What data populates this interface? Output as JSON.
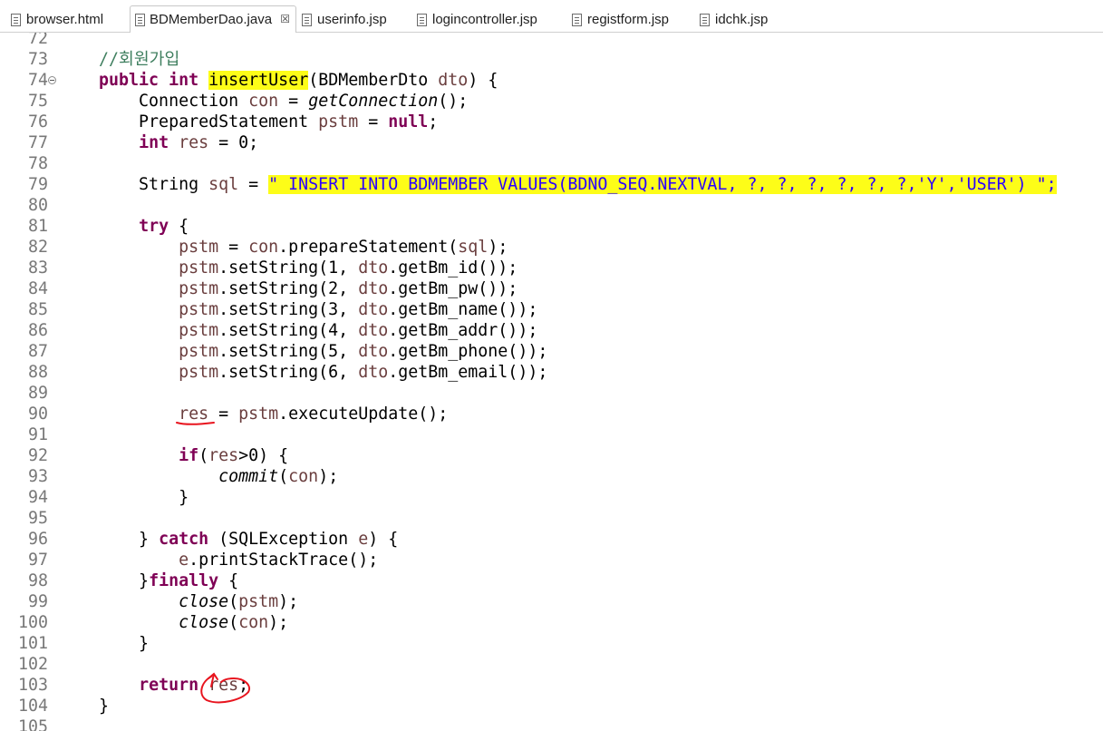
{
  "tabs": [
    {
      "label": "browser.html",
      "active": false
    },
    {
      "label": "BDMemberDao.java",
      "active": true,
      "close": "☒"
    },
    {
      "label": "userinfo.jsp",
      "active": false
    },
    {
      "label": "logincontroller.jsp",
      "active": false
    },
    {
      "label": "registform.jsp",
      "active": false
    },
    {
      "label": "idchk.jsp",
      "active": false
    }
  ],
  "editor": {
    "lines": [
      {
        "n": "72",
        "tokens": []
      },
      {
        "n": "73",
        "tokens": [
          {
            "t": "    //회원가입",
            "c": "cm"
          }
        ]
      },
      {
        "n": "74",
        "fold": true,
        "tokens": [
          {
            "t": "    "
          },
          {
            "t": "public",
            "c": "kw"
          },
          {
            "t": " "
          },
          {
            "t": "int",
            "c": "kw"
          },
          {
            "t": " "
          },
          {
            "t": "insertUser",
            "c": "hl"
          },
          {
            "t": "(BDMemberDto "
          },
          {
            "t": "dto",
            "c": "fld"
          },
          {
            "t": ") {"
          }
        ]
      },
      {
        "n": "75",
        "tokens": [
          {
            "t": "        Connection "
          },
          {
            "t": "con",
            "c": "fld"
          },
          {
            "t": " = "
          },
          {
            "t": "getConnection",
            "c": "it"
          },
          {
            "t": "();"
          }
        ]
      },
      {
        "n": "76",
        "tokens": [
          {
            "t": "        PreparedStatement "
          },
          {
            "t": "pstm",
            "c": "fld"
          },
          {
            "t": " = "
          },
          {
            "t": "null",
            "c": "kw"
          },
          {
            "t": ";"
          }
        ]
      },
      {
        "n": "77",
        "tokens": [
          {
            "t": "        "
          },
          {
            "t": "int",
            "c": "kw"
          },
          {
            "t": " "
          },
          {
            "t": "res",
            "c": "fld"
          },
          {
            "t": " = 0;"
          }
        ]
      },
      {
        "n": "78",
        "tokens": []
      },
      {
        "n": "79",
        "tokens": [
          {
            "t": "        String "
          },
          {
            "t": "sql",
            "c": "fld"
          },
          {
            "t": " = "
          },
          {
            "t": "\" INSERT INTO BDMEMBER VALUES(BDNO_SEQ.NEXTVAL, ?, ?, ?, ?, ?, ?,'Y','USER') \";",
            "c": "str hl"
          }
        ]
      },
      {
        "n": "80",
        "tokens": []
      },
      {
        "n": "81",
        "tokens": [
          {
            "t": "        "
          },
          {
            "t": "try",
            "c": "kw"
          },
          {
            "t": " {"
          }
        ]
      },
      {
        "n": "82",
        "tokens": [
          {
            "t": "            "
          },
          {
            "t": "pstm",
            "c": "fld"
          },
          {
            "t": " = "
          },
          {
            "t": "con",
            "c": "fld"
          },
          {
            "t": ".prepareStatement("
          },
          {
            "t": "sql",
            "c": "fld"
          },
          {
            "t": ");"
          }
        ]
      },
      {
        "n": "83",
        "tokens": [
          {
            "t": "            "
          },
          {
            "t": "pstm",
            "c": "fld"
          },
          {
            "t": ".setString(1, "
          },
          {
            "t": "dto",
            "c": "fld"
          },
          {
            "t": ".getBm_id());"
          }
        ]
      },
      {
        "n": "84",
        "tokens": [
          {
            "t": "            "
          },
          {
            "t": "pstm",
            "c": "fld"
          },
          {
            "t": ".setString(2, "
          },
          {
            "t": "dto",
            "c": "fld"
          },
          {
            "t": ".getBm_pw());"
          }
        ]
      },
      {
        "n": "85",
        "tokens": [
          {
            "t": "            "
          },
          {
            "t": "pstm",
            "c": "fld"
          },
          {
            "t": ".setString(3, "
          },
          {
            "t": "dto",
            "c": "fld"
          },
          {
            "t": ".getBm_name());"
          }
        ]
      },
      {
        "n": "86",
        "tokens": [
          {
            "t": "            "
          },
          {
            "t": "pstm",
            "c": "fld"
          },
          {
            "t": ".setString(4, "
          },
          {
            "t": "dto",
            "c": "fld"
          },
          {
            "t": ".getBm_addr());"
          }
        ]
      },
      {
        "n": "87",
        "tokens": [
          {
            "t": "            "
          },
          {
            "t": "pstm",
            "c": "fld"
          },
          {
            "t": ".setString(5, "
          },
          {
            "t": "dto",
            "c": "fld"
          },
          {
            "t": ".getBm_phone());"
          }
        ]
      },
      {
        "n": "88",
        "tokens": [
          {
            "t": "            "
          },
          {
            "t": "pstm",
            "c": "fld"
          },
          {
            "t": ".setString(6, "
          },
          {
            "t": "dto",
            "c": "fld"
          },
          {
            "t": ".getBm_email());"
          }
        ]
      },
      {
        "n": "89",
        "tokens": []
      },
      {
        "n": "90",
        "tokens": [
          {
            "t": "            "
          },
          {
            "t": "res",
            "c": "fld"
          },
          {
            "t": " = "
          },
          {
            "t": "pstm",
            "c": "fld"
          },
          {
            "t": ".executeUpdate();"
          }
        ]
      },
      {
        "n": "91",
        "tokens": []
      },
      {
        "n": "92",
        "tokens": [
          {
            "t": "            "
          },
          {
            "t": "if",
            "c": "kw"
          },
          {
            "t": "("
          },
          {
            "t": "res",
            "c": "fld"
          },
          {
            "t": ">0) {"
          }
        ]
      },
      {
        "n": "93",
        "tokens": [
          {
            "t": "                "
          },
          {
            "t": "commit",
            "c": "it"
          },
          {
            "t": "("
          },
          {
            "t": "con",
            "c": "fld"
          },
          {
            "t": ");"
          }
        ]
      },
      {
        "n": "94",
        "tokens": [
          {
            "t": "            }"
          }
        ]
      },
      {
        "n": "95",
        "tokens": []
      },
      {
        "n": "96",
        "tokens": [
          {
            "t": "        } "
          },
          {
            "t": "catch",
            "c": "kw"
          },
          {
            "t": " (SQLException "
          },
          {
            "t": "e",
            "c": "fld"
          },
          {
            "t": ") {"
          }
        ]
      },
      {
        "n": "97",
        "tokens": [
          {
            "t": "            "
          },
          {
            "t": "e",
            "c": "fld"
          },
          {
            "t": ".printStackTrace();"
          }
        ]
      },
      {
        "n": "98",
        "tokens": [
          {
            "t": "        }"
          },
          {
            "t": "finally",
            "c": "kw"
          },
          {
            "t": " {"
          }
        ]
      },
      {
        "n": "99",
        "tokens": [
          {
            "t": "            "
          },
          {
            "t": "close",
            "c": "it"
          },
          {
            "t": "("
          },
          {
            "t": "pstm",
            "c": "fld"
          },
          {
            "t": ");"
          }
        ]
      },
      {
        "n": "100",
        "tokens": [
          {
            "t": "            "
          },
          {
            "t": "close",
            "c": "it"
          },
          {
            "t": "("
          },
          {
            "t": "con",
            "c": "fld"
          },
          {
            "t": ");"
          }
        ]
      },
      {
        "n": "101",
        "tokens": [
          {
            "t": "        }"
          }
        ]
      },
      {
        "n": "102",
        "tokens": []
      },
      {
        "n": "103",
        "tokens": [
          {
            "t": "        "
          },
          {
            "t": "return",
            "c": "kw"
          },
          {
            "t": " "
          },
          {
            "t": "res",
            "c": "fld"
          },
          {
            "t": ";"
          }
        ]
      },
      {
        "n": "104",
        "tokens": [
          {
            "t": "    }"
          }
        ]
      },
      {
        "n": "105",
        "tokens": []
      }
    ]
  },
  "colors": {
    "keyword": "#7f0055",
    "comment": "#3f7f5f",
    "string": "#2a00ff",
    "field": "#6a3e3e",
    "highlight": "#fdfd18",
    "annotation": "#e8141e"
  }
}
